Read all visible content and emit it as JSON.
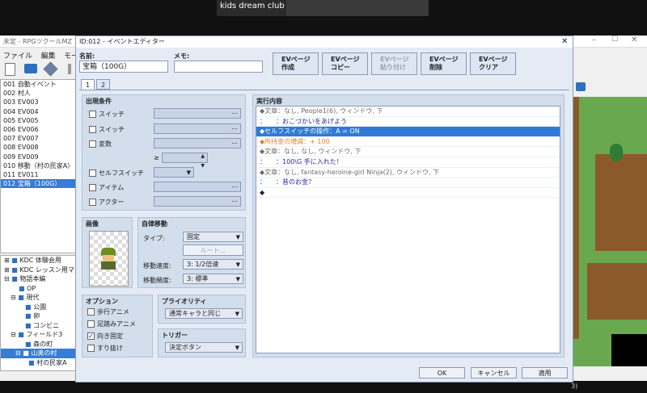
{
  "call": {
    "participant_name": "kids dream club"
  },
  "main_window": {
    "title": "未定 - RPGツクールMZ",
    "menu": [
      "ファイル",
      "編集",
      "モー"
    ]
  },
  "event_list": [
    "001 自動イベント",
    "002 村人",
    "003 EV003",
    "004 EV004",
    "005 EV005",
    "006 EV006",
    "007 EV007",
    "008 EV008",
    "009 EV009",
    "010 移動（村の民家A）",
    "011 EV011",
    "012 宝箱（100G）"
  ],
  "map_tree": [
    "KDC 体験会用",
    "KDC レッスン用マ",
    "物語本編",
    "OP",
    "現代",
    "公園",
    "卵",
    "コンビニ",
    "フィールド3",
    "森の町",
    "山奥の村",
    "村の民家A"
  ],
  "map_status": "3)",
  "dialog": {
    "title": "ID:012 - イベントエディター",
    "name_label": "名前:",
    "name_value": "宝箱（100G）",
    "memo_label": "メモ:",
    "memo_value": "",
    "ev_buttons": [
      {
        "line1": "EVページ",
        "line2": "作成"
      },
      {
        "line1": "EVページ",
        "line2": "コピー"
      },
      {
        "line1": "EVページ",
        "line2": "貼り付け"
      },
      {
        "line1": "EVページ",
        "line2": "削除"
      },
      {
        "line1": "EVページ",
        "line2": "クリア"
      }
    ],
    "tabs": [
      "1",
      "2"
    ],
    "conditions": {
      "title": "出現条件",
      "items": [
        "スイッチ",
        "スイッチ",
        "変数",
        "セルフスイッチ",
        "アイテム",
        "アクター"
      ],
      "ellipsis": "...",
      "gte": "≥"
    },
    "image": {
      "title": "画像"
    },
    "movement": {
      "title": "自律移動",
      "type_label": "タイプ:",
      "type_value": "固定",
      "route_button": "ルート...",
      "speed_label": "移動速度:",
      "speed_value": "3: 1/2倍速",
      "freq_label": "移動頻度:",
      "freq_value": "3: 標準"
    },
    "options": {
      "title": "オプション",
      "items": [
        {
          "label": "歩行アニメ",
          "checked": false
        },
        {
          "label": "足踏みアニメ",
          "checked": false
        },
        {
          "label": "向き固定",
          "checked": true
        },
        {
          "label": "すり抜け",
          "checked": false
        }
      ]
    },
    "priority": {
      "title": "プライオリティ",
      "value": "通常キャラと同じ"
    },
    "trigger": {
      "title": "トリガー",
      "value": "決定ボタン"
    },
    "contents": {
      "title": "実行内容",
      "commands": [
        {
          "text": "◆文章：なし, People1(6), ウィンドウ, 下",
          "color": "#6b6b6b"
        },
        {
          "text": "：　　：おこづかいをあげよう",
          "color": "#2a2a9a"
        },
        {
          "text": "◆セルフスイッチの操作：A = ON",
          "color": "#ffffff"
        },
        {
          "text": "◆所持金の増減：+ 100",
          "color": "#d9822b"
        },
        {
          "text": "◆文章：なし, なし, ウィンドウ, 下",
          "color": "#6b6b6b"
        },
        {
          "text": "：　　：100\\G 手に入れた！",
          "color": "#2a2a9a"
        },
        {
          "text": "◆文章：なし, fantasy-heroine-girl Ninja(2), ウィンドウ, 下",
          "color": "#6b6b6b"
        },
        {
          "text": "：　　：昔のお金？",
          "color": "#2a2a9a"
        },
        {
          "text": "◆",
          "color": "#222222"
        }
      ]
    },
    "buttons": {
      "ok": "OK",
      "cancel": "キャンセル",
      "apply": "適用"
    }
  }
}
